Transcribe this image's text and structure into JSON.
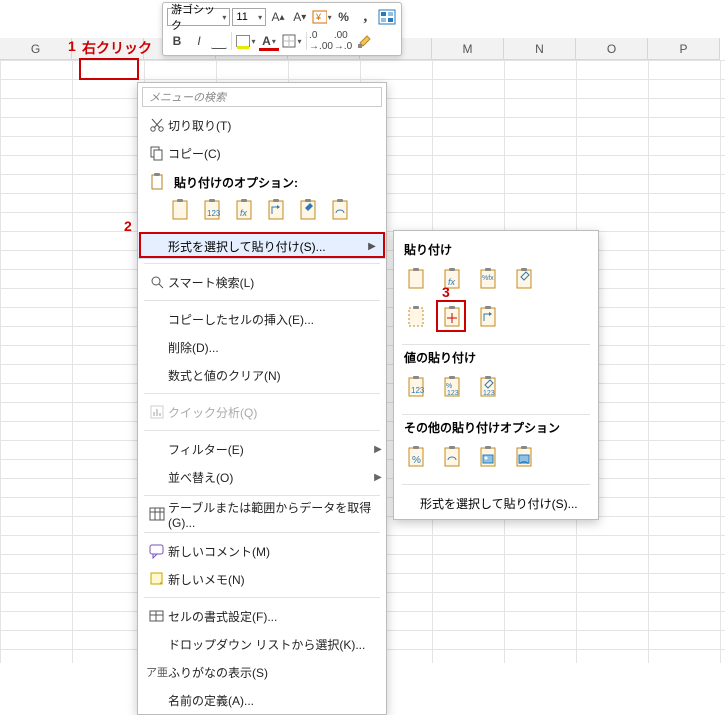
{
  "columns": [
    "G",
    "",
    "",
    "",
    "",
    "",
    "M",
    "N",
    "O",
    "P"
  ],
  "mini_toolbar": {
    "font_name": "游ゴシック",
    "font_size": "11"
  },
  "annotations": {
    "a1_num": "1",
    "a1_text": "右クリック",
    "a2_num": "2",
    "a3_num": "3"
  },
  "ctx": {
    "search_placeholder": "メニューの検索",
    "cut": "切り取り(T)",
    "copy": "コピー(C)",
    "paste_header": "貼り付けのオプション:",
    "paste_special": "形式を選択して貼り付け(S)...",
    "smart_lookup": "スマート検索(L)",
    "insert_copied": "コピーしたセルの挿入(E)...",
    "delete": "削除(D)...",
    "clear": "数式と値のクリア(N)",
    "quick_analysis": "クイック分析(Q)",
    "filter": "フィルター(E)",
    "sort": "並べ替え(O)",
    "get_data": "テーブルまたは範囲からデータを取得(G)...",
    "new_comment": "新しいコメント(M)",
    "new_note": "新しいメモ(N)",
    "format_cells": "セルの書式設定(F)...",
    "dropdown_select": "ドロップダウン リストから選択(K)...",
    "furigana": "ふりがなの表示(S)",
    "define_name": "名前の定義(A)..."
  },
  "sub": {
    "paste_hdr": "貼り付け",
    "values_hdr": "値の貼り付け",
    "other_hdr": "その他の貼り付けオプション",
    "foot": "形式を選択して貼り付け(S)..."
  }
}
